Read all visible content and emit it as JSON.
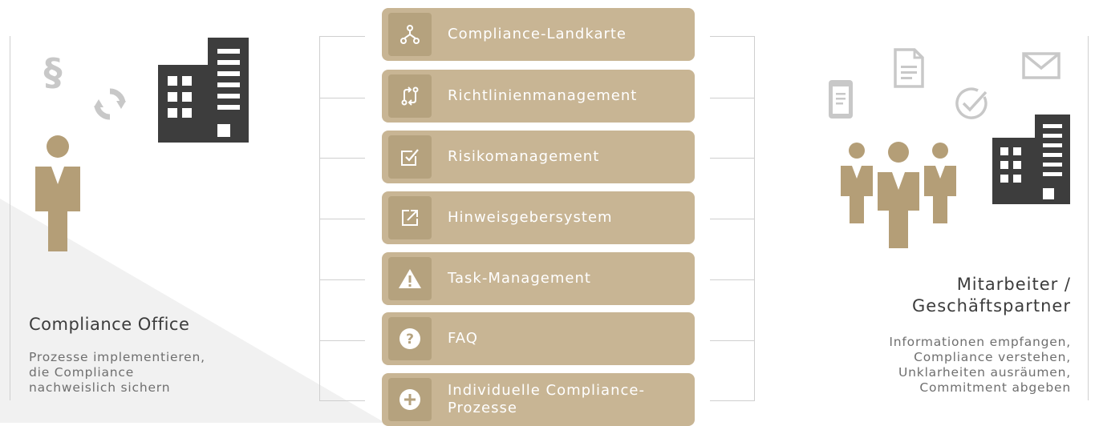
{
  "left_panel": {
    "title": "Compliance Office",
    "description_lines": [
      "Prozesse implementieren,",
      "die Compliance",
      "nachweislich sichern"
    ],
    "icons": [
      "paragraph-icon",
      "sync-icon",
      "building-icon",
      "person-icon"
    ]
  },
  "menu": {
    "items": [
      {
        "label": "Compliance-Landkarte",
        "icon": "sitemap-icon"
      },
      {
        "label": "Richtlinienmanagement",
        "icon": "git-compare-icon"
      },
      {
        "label": "Risikomanagement",
        "icon": "checkbox-icon"
      },
      {
        "label": "Hinweisgebersystem",
        "icon": "external-link-icon"
      },
      {
        "label": "Task-Management",
        "icon": "warning-icon"
      },
      {
        "label": "FAQ",
        "icon": "question-icon"
      },
      {
        "label": "Individuelle Compliance-Prozesse",
        "icon": "plus-circle-icon"
      }
    ]
  },
  "right_panel": {
    "title_lines": [
      "Mitarbeiter /",
      "Geschäftspartner"
    ],
    "description_lines": [
      "Informationen empfangen,",
      "Compliance verstehen,",
      "Unklarheiten ausräumen,",
      "Commitment abgeben"
    ],
    "icons": [
      "phone-icon",
      "document-icon",
      "check-circle-icon",
      "envelope-icon",
      "people-icon",
      "building-icon"
    ]
  },
  "colors": {
    "gold": "#c8b594",
    "gold_dark": "#b5a27e",
    "dark_gray": "#3d3d3d",
    "light_gray": "#cfcfcf",
    "text_gray": "#6f6f6f"
  }
}
